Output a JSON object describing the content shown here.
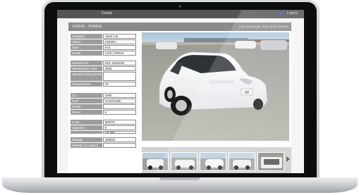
{
  "topbar": {
    "tab_label": "Details",
    "logout_label": "Logout"
  },
  "header": {
    "vehicle_title": "JU0045 : HONDA",
    "last_update": "Last update date : 2011-05-02 16:53:00"
  },
  "specs": {
    "group1": [
      {
        "label": "Category",
        "value": "Used Car"
      },
      {
        "label": "Maker",
        "value": "HONDA"
      },
      {
        "label": "Type",
        "value": "ES1"
      },
      {
        "label": "Model",
        "value": "CIVIC FERIO"
      }
    ],
    "group2": [
      {
        "label": "Chassis No.",
        "value": "ES1-1605039"
      },
      {
        "label": "Manufacture Year",
        "value": "2005"
      },
      {
        "label": "Manufacturing Month",
        "value": ""
      },
      {
        "label": "Transmission",
        "value": "AT"
      }
    ],
    "group3": [
      {
        "label": "CC",
        "value": "1500"
      },
      {
        "label": "Fuel",
        "value": "GASOLINE"
      },
      {
        "label": "Grade",
        "value": ""
      },
      {
        "label": "Doors",
        "value": "5"
      }
    ],
    "group4": [
      {
        "label": "Color",
        "value": "WHITE"
      },
      {
        "label": "Capacity",
        "value": "5"
      },
      {
        "label": "",
        "value": "1.5L Blue"
      }
    ],
    "group5": [
      {
        "label": "Mileage",
        "value": "199000"
      },
      {
        "label": "Mileage (in pages)",
        "value": ""
      }
    ]
  },
  "photo": {
    "plate_text": "88"
  },
  "colors": {
    "header_gray": "#8a8a8a",
    "label_gray": "#9d9d9d",
    "car_white": "#f5f6f7"
  }
}
